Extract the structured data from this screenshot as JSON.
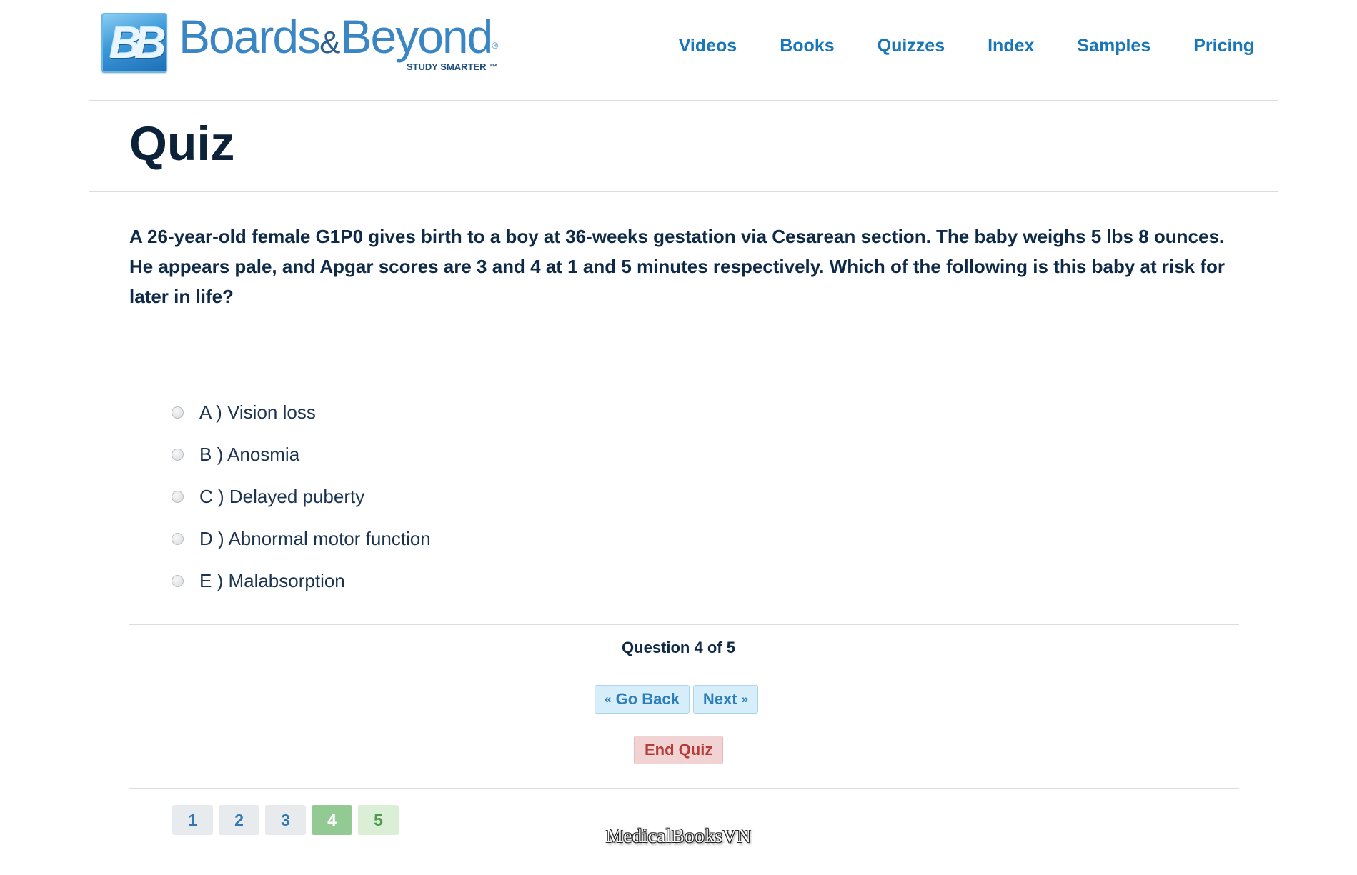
{
  "header": {
    "logo_mark": "BB",
    "logo_name_left": "Boards",
    "logo_amp": "&",
    "logo_name_right": "Beyond",
    "logo_reg": "®",
    "logo_tagline": "STUDY SMARTER ™",
    "nav": [
      "Videos",
      "Books",
      "Quizzes",
      "Index",
      "Samples",
      "Pricing"
    ]
  },
  "page_title": "Quiz",
  "question": {
    "text": "A 26-year-old female G1P0 gives birth to a boy at 36-weeks gestation via Cesarean section. The baby weighs 5 lbs 8 ounces. He appears pale, and Apgar scores are 3 and 4 at 1 and 5 minutes respectively. Which of the following is this baby at risk for later in life?",
    "options": [
      "A ) Vision loss",
      "B ) Anosmia",
      "C ) Delayed puberty",
      "D ) Abnormal motor function",
      "E ) Malabsorption"
    ]
  },
  "progress": {
    "label": "Question 4 of 5",
    "current": 4,
    "total": 5
  },
  "controls": {
    "back_quote": "«",
    "back_label": "Go Back",
    "next_label": "Next",
    "next_quote": "»",
    "end_label": "End Quiz"
  },
  "pager": [
    "1",
    "2",
    "3",
    "4",
    "5"
  ],
  "watermark": "MedicalBooksVN",
  "colors": {
    "brand_blue": "#1976b8",
    "title_navy": "#0b2238",
    "current_page_green": "#93c993",
    "answered_page_green": "#dbeed6",
    "end_quiz_red": "#b43d3b"
  }
}
